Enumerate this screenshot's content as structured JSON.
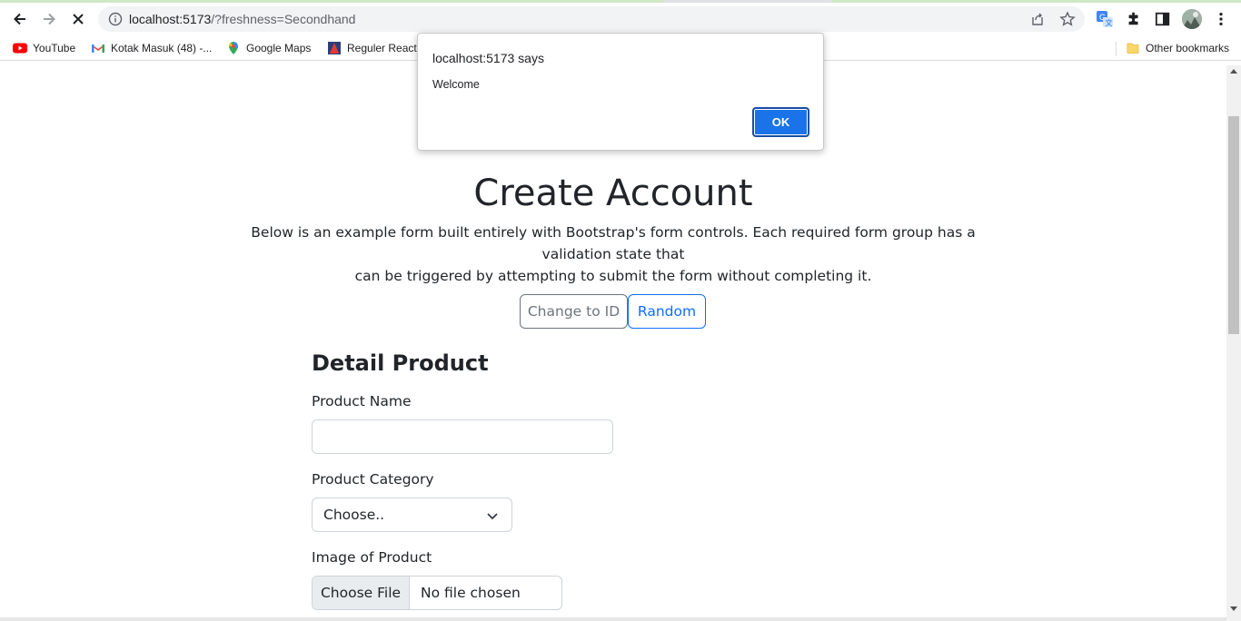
{
  "browser": {
    "url_host": "localhost:5173",
    "url_path": "/?freshness=Secondhand",
    "bookmarks": [
      {
        "label": "YouTube",
        "icon": "youtube-icon"
      },
      {
        "label": "Kotak Masuk (48) -...",
        "icon": "gmail-icon"
      },
      {
        "label": "Google Maps",
        "icon": "maps-pin-icon"
      },
      {
        "label": "Reguler React",
        "icon": "reguler-react-icon"
      }
    ],
    "other_bookmarks": "Other bookmarks"
  },
  "dialog": {
    "title": "localhost:5173 says",
    "message": "Welcome",
    "ok_label": "OK"
  },
  "page": {
    "title": "Create Account",
    "lead_line1": "Below is an example form built entirely with Bootstrap's form controls. Each required form group has a validation state that",
    "lead_line2": "can be triggered by attempting to submit the form without completing it.",
    "change_button": "Change to ID",
    "random_button": "Random",
    "section_title": "Detail Product",
    "product_name_label": "Product Name",
    "product_name_value": "",
    "category_label": "Product Category",
    "category_selected": "Choose..",
    "image_label": "Image of Product",
    "choose_file": "Choose File",
    "no_file": "No file chosen"
  },
  "colors": {
    "primary": "#0d6efd",
    "secondary": "#6c757d",
    "dialog_ok": "#1a73e8"
  }
}
